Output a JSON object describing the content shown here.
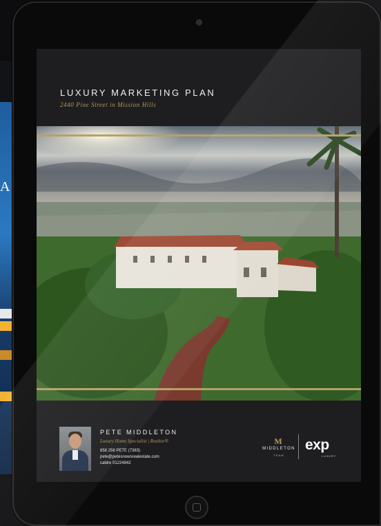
{
  "background_tablet": {
    "visible_letter": "A",
    "accent_colors": [
      "#f2b233",
      "#e3e3e3",
      "#1f5d9e"
    ]
  },
  "document": {
    "title": "LUXURY MARKETING PLAN",
    "subtitle": "2440 Pine Street in Mission Hills",
    "accent_color": "#b8a06a"
  },
  "photo": {
    "icon": "aerial-mansion-photo"
  },
  "agent": {
    "name": "PETE MIDDLETON",
    "role": "Luxury Home Specialist | Realtor®",
    "phone": "858 258 PETE (7383)",
    "email": "pete@petesnowsrealestate.com",
    "license": "caldre 01224842"
  },
  "logos": {
    "team_mark": "M",
    "team_name": "MIDDLETON",
    "team_sub": "TEAM",
    "brokerage": "exp",
    "brokerage_sub": "LUXURY"
  }
}
